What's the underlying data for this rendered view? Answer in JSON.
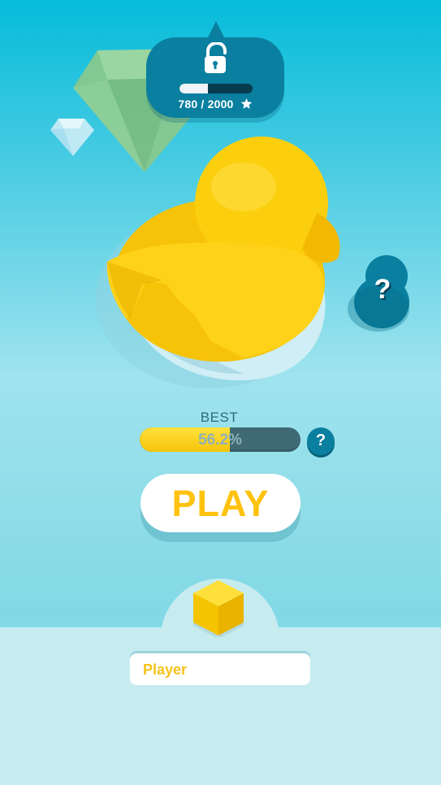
{
  "unlock": {
    "counter_value": "780",
    "counter_sep": " / ",
    "counter_goal": "2000",
    "progress": 0.39,
    "icon": "unlocked-padlock-icon",
    "star_icon": "star-icon"
  },
  "help": {
    "label": "?"
  },
  "best": {
    "label": "BEST",
    "percent_text": "56.2%",
    "progress": 0.562,
    "help_label": "?"
  },
  "play": {
    "label": "PLAY"
  },
  "player": {
    "name_value": "Player",
    "avatar_icon": "yellow-cube-icon"
  },
  "colors": {
    "accent_yellow": "#ffc20e",
    "badge_blue": "#0a7f9f",
    "panel": "#c6ecf0"
  }
}
